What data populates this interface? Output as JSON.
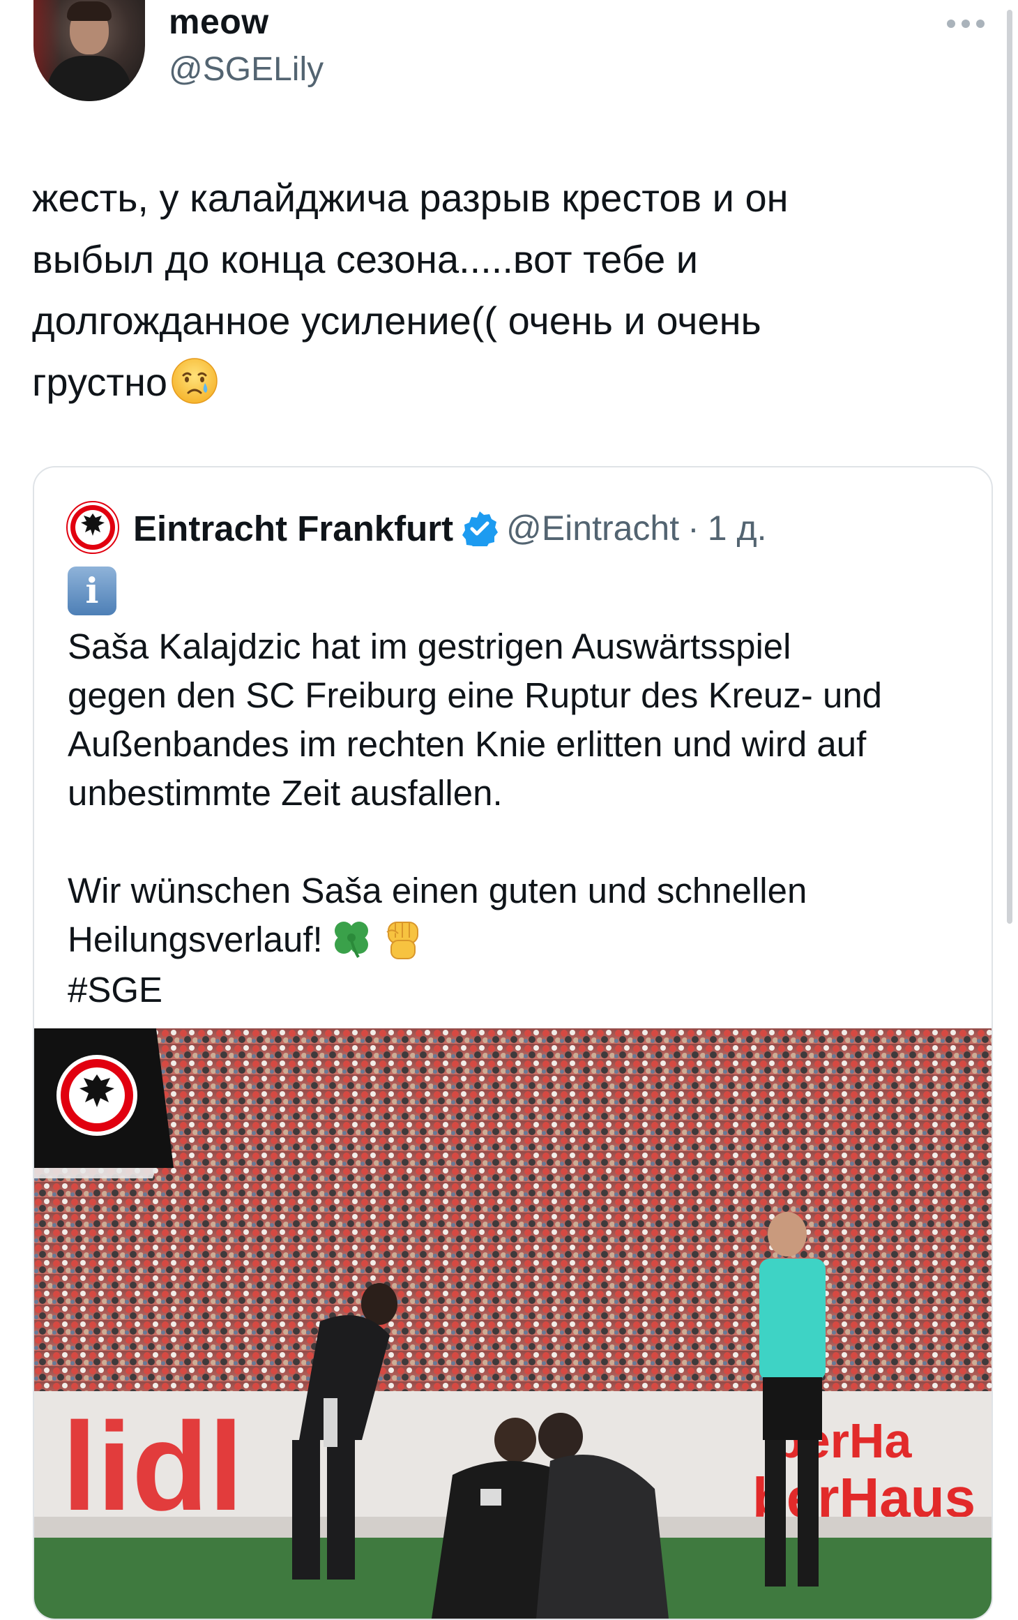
{
  "author": {
    "name": "meow",
    "handle": "@SGELily",
    "avatar_icon": "profile-photo"
  },
  "tweet": {
    "lines": [
      "жесть, у калайджича разрыв крестов и он",
      "выбыл до конца сезона.....вот тебе и",
      "долгожданное усиление(( очень и очень",
      "грустно"
    ],
    "emoji": "crying-face-emoji"
  },
  "quoted": {
    "name": "Eintracht Frankfurt",
    "handle": "@Eintracht",
    "separator": "·",
    "time": "1 д.",
    "verified": true,
    "info_icon_glyph": "i",
    "paragraph1": [
      "Saša Kalajdzic hat im gestrigen Auswärtsspiel",
      "gegen den SC Freiburg eine Ruptur des Kreuz- und",
      "Außenbandes im rechten Knie erlitten und wird auf",
      "unbestimmte Zeit ausfallen."
    ],
    "paragraph2": [
      "Wir wünschen Saša einen guten und schnellen",
      "Heilungsverlauf!"
    ],
    "hashtag": "#SGE",
    "media": {
      "description_icon": "stadium-photo",
      "banner_text_1": "berHa",
      "banner_text_2": "berHaus"
    }
  },
  "colors": {
    "text": "#0f1419",
    "secondary": "#536471",
    "verified": "#1d9bf0",
    "eintracht_red": "#e1000f"
  }
}
